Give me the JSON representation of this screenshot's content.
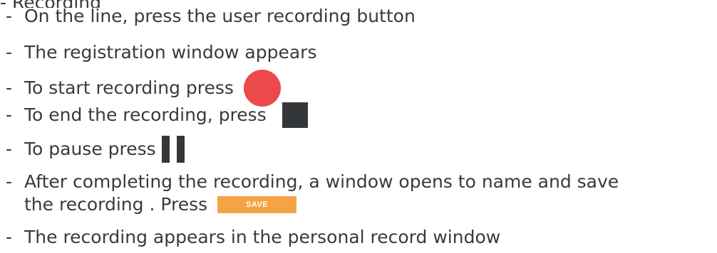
{
  "header_fragment": "- Recording",
  "steps": {
    "s1": "On the line, press the user recording button",
    "s2": "The registration window appears",
    "s3": "To start recording press",
    "s4": "To end the recording, press",
    "s5": "To pause press",
    "s6_line1": "After completing the recording, a window opens to name and save",
    "s6_line2": "the recording . Press",
    "s7": "The recording appears in the personal record window"
  },
  "save_button_label": "SAVE",
  "icons": {
    "record": "record-circle-icon",
    "stop": "stop-square-icon",
    "pause": "pause-bars-icon"
  },
  "colors": {
    "text": "#3a3a3a",
    "record": "#ec4a4a",
    "stop_pause": "#34373a",
    "save_button": "#f5a445"
  }
}
